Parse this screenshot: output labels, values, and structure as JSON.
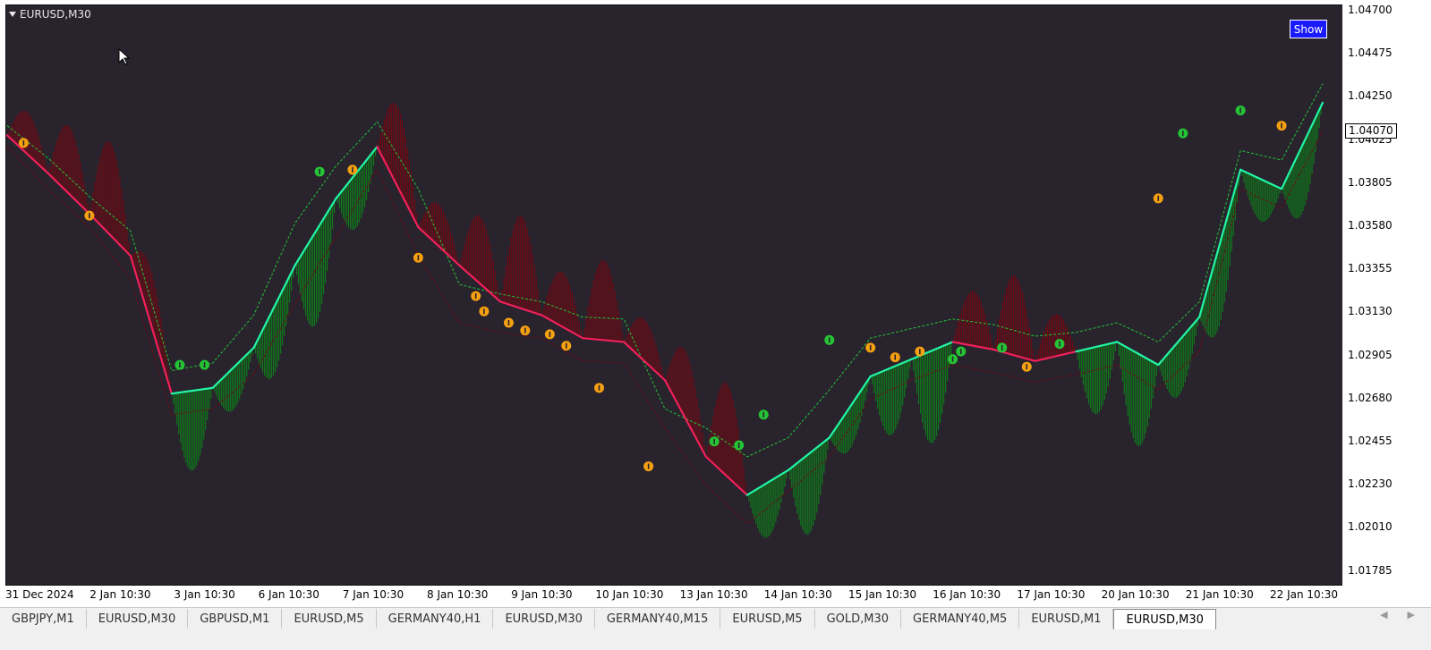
{
  "window": {
    "title": "EURUSD,M30",
    "show_button": "Show"
  },
  "price_axis": {
    "labels": [
      "1.04700",
      "1.04475",
      "1.04250",
      "1.04025",
      "1.03805",
      "1.03580",
      "1.03355",
      "1.03130",
      "1.02905",
      "1.02680",
      "1.02455",
      "1.02230",
      "1.02010",
      "1.01785"
    ],
    "current_price": "1.04070"
  },
  "time_axis": {
    "labels": [
      "31 Dec 2024",
      "2 Jan 10:30",
      "3 Jan 10:30",
      "6 Jan 10:30",
      "7 Jan 10:30",
      "8 Jan 10:30",
      "9 Jan 10:30",
      "10 Jan 10:30",
      "13 Jan 10:30",
      "14 Jan 10:30",
      "15 Jan 10:30",
      "16 Jan 10:30",
      "17 Jan 10:30",
      "20 Jan 10:30",
      "21 Jan 10:30",
      "22 Jan 10:30"
    ]
  },
  "tabs": [
    "GBPJPY,M1",
    "EURUSD,M30",
    "GBPUSD,M1",
    "EURUSD,M5",
    "GERMANY40,H1",
    "EURUSD,M30",
    "GERMANY40,M15",
    "EURUSD,M5",
    "GOLD,M30",
    "GERMANY40,M5",
    "EURUSD,M1",
    "EURUSD,M30"
  ],
  "active_tab_index": 11,
  "tab_nav_icons": [
    "tab-scroll-left-icon",
    "tab-scroll-right-icon"
  ],
  "colors": {
    "background": "#28232d",
    "up_line": "#22f5a5",
    "down_line": "#f0205a",
    "up_fill": "#0f7a1a",
    "down_fill": "#6e0a14",
    "up_signal": "#25c435",
    "down_signal": "#f5a010",
    "show_button": "#1a1aff"
  },
  "chart_data": {
    "type": "line",
    "symbol": "EURUSD",
    "timeframe": "M30",
    "ylim": [
      1.0175,
      1.0474
    ],
    "x": [
      0,
      0.5,
      1,
      1.5,
      2,
      2.5,
      3,
      3.5,
      4,
      4.5,
      5,
      5.5,
      6,
      6.5,
      7,
      7.5,
      8,
      8.5,
      9,
      9.5,
      10,
      10.5,
      11,
      11.5,
      12,
      12.5,
      13,
      13.5,
      14,
      14.5,
      15,
      15.5,
      16
    ],
    "x_tick_labels": [
      "31 Dec 2024",
      "2 Jan 10:30",
      "3 Jan 10:30",
      "6 Jan 10:30",
      "7 Jan 10:30",
      "8 Jan 10:30",
      "9 Jan 10:30",
      "10 Jan 10:30",
      "13 Jan 10:30",
      "14 Jan 10:30",
      "15 Jan 10:30",
      "16 Jan 10:30",
      "17 Jan 10:30",
      "20 Jan 10:30",
      "21 Jan 10:30",
      "22 Jan 10:30"
    ],
    "trend_line": [
      1.0408,
      1.0388,
      1.0367,
      1.0345,
      1.0273,
      1.0276,
      1.0297,
      1.034,
      1.0375,
      1.0402,
      1.036,
      1.034,
      1.0321,
      1.0314,
      1.0302,
      1.03,
      1.028,
      1.024,
      1.022,
      1.0233,
      1.025,
      1.0282,
      1.0291,
      1.03,
      1.0296,
      1.029,
      1.0295,
      1.03,
      1.0288,
      1.0313,
      1.039,
      1.038,
      1.0425
    ],
    "direction": [
      "down",
      "down",
      "down",
      "down",
      "up",
      "up",
      "up",
      "up",
      "up",
      "down",
      "down",
      "down",
      "down",
      "down",
      "down",
      "down",
      "down",
      "down",
      "up",
      "up",
      "up",
      "up",
      "up",
      "down",
      "down",
      "down",
      "up",
      "up",
      "up",
      "up",
      "up",
      "up",
      "down"
    ],
    "upper_band": [
      1.0413,
      1.0396,
      1.0376,
      1.0358,
      1.0285,
      1.0289,
      1.0314,
      1.0362,
      1.0392,
      1.0415,
      1.038,
      1.033,
      1.0325,
      1.0321,
      1.0313,
      1.0312,
      1.0265,
      1.0255,
      1.024,
      1.025,
      1.0275,
      1.0302,
      1.0307,
      1.0312,
      1.0309,
      1.0303,
      1.0305,
      1.031,
      1.03,
      1.0321,
      1.04,
      1.0395,
      1.0435
    ],
    "lower_band": [
      1.0402,
      1.038,
      1.036,
      1.0333,
      1.0262,
      1.0265,
      1.0283,
      1.032,
      1.0355,
      1.039,
      1.0345,
      1.031,
      1.0305,
      1.0302,
      1.029,
      1.0289,
      1.0255,
      1.0225,
      1.0205,
      1.0222,
      1.024,
      1.027,
      1.028,
      1.0288,
      1.0284,
      1.0279,
      1.0283,
      1.0288,
      1.0275,
      1.0295,
      1.038,
      1.037,
      1.041
    ],
    "signals": [
      {
        "x": 0.2,
        "y": 1.0404,
        "type": "down"
      },
      {
        "x": 1.0,
        "y": 1.0366,
        "type": "down"
      },
      {
        "x": 2.1,
        "y": 1.0288,
        "type": "up"
      },
      {
        "x": 2.4,
        "y": 1.0288,
        "type": "up"
      },
      {
        "x": 3.8,
        "y": 1.0389,
        "type": "up"
      },
      {
        "x": 4.2,
        "y": 1.039,
        "type": "down"
      },
      {
        "x": 5.0,
        "y": 1.0344,
        "type": "down"
      },
      {
        "x": 5.7,
        "y": 1.0324,
        "type": "down"
      },
      {
        "x": 5.8,
        "y": 1.0316,
        "type": "down"
      },
      {
        "x": 6.1,
        "y": 1.031,
        "type": "down"
      },
      {
        "x": 6.3,
        "y": 1.0306,
        "type": "down"
      },
      {
        "x": 6.6,
        "y": 1.0304,
        "type": "down"
      },
      {
        "x": 6.8,
        "y": 1.0298,
        "type": "down"
      },
      {
        "x": 7.2,
        "y": 1.0276,
        "type": "down"
      },
      {
        "x": 7.8,
        "y": 1.0235,
        "type": "down"
      },
      {
        "x": 8.6,
        "y": 1.0248,
        "type": "up"
      },
      {
        "x": 8.9,
        "y": 1.0246,
        "type": "up"
      },
      {
        "x": 9.2,
        "y": 1.0262,
        "type": "up"
      },
      {
        "x": 10.0,
        "y": 1.0301,
        "type": "up"
      },
      {
        "x": 10.5,
        "y": 1.0297,
        "type": "down"
      },
      {
        "x": 10.8,
        "y": 1.0292,
        "type": "down"
      },
      {
        "x": 11.1,
        "y": 1.0295,
        "type": "down"
      },
      {
        "x": 11.5,
        "y": 1.0291,
        "type": "up"
      },
      {
        "x": 11.6,
        "y": 1.0295,
        "type": "up"
      },
      {
        "x": 12.1,
        "y": 1.0297,
        "type": "up"
      },
      {
        "x": 12.4,
        "y": 1.0287,
        "type": "down"
      },
      {
        "x": 12.8,
        "y": 1.0299,
        "type": "up"
      },
      {
        "x": 14.0,
        "y": 1.0375,
        "type": "down"
      },
      {
        "x": 14.3,
        "y": 1.0409,
        "type": "up"
      },
      {
        "x": 15.0,
        "y": 1.0421,
        "type": "up"
      },
      {
        "x": 15.5,
        "y": 1.0413,
        "type": "down"
      }
    ]
  }
}
